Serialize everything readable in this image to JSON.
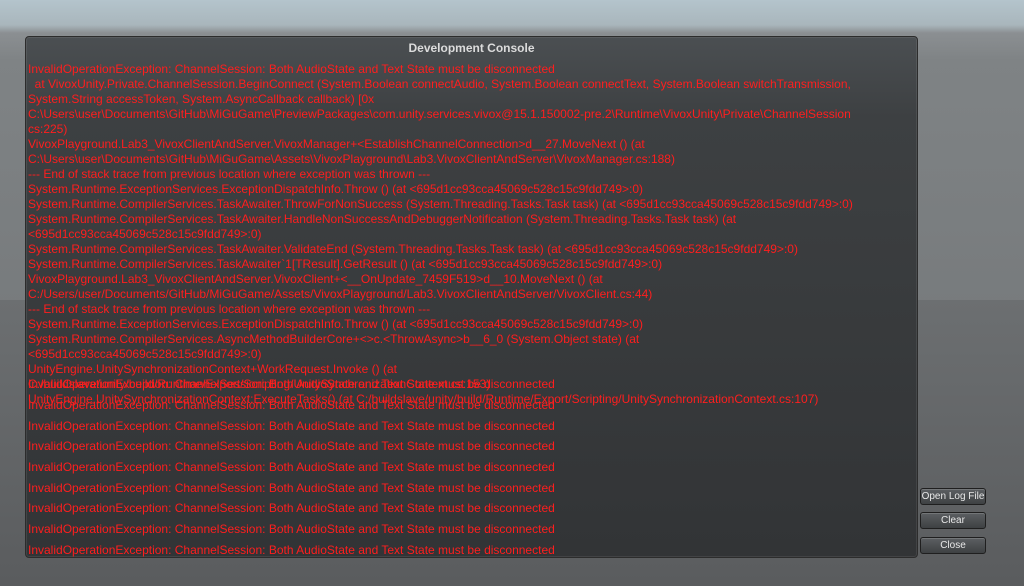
{
  "console": {
    "title": "Development Console",
    "stack_lines": [
      "InvalidOperationException: ChannelSession: Both AudioState and Text State must be disconnected",
      "  at VivoxUnity.Private.ChannelSession.BeginConnect (System.Boolean connectAudio, System.Boolean connectText, System.Boolean switchTransmission,",
      "System.String accessToken, System.AsyncCallback callback) [0x",
      "C:\\Users\\user\\Documents\\GitHub\\MiGuGame\\PreviewPackages\\com.unity.services.vivox@15.1.150002-pre.2\\Runtime\\VivoxUnity\\Private\\ChannelSession",
      "cs:225)",
      "VivoxPlayground.Lab3_VivoxClientAndServer.VivoxManager+<EstablishChannelConnection>d__27.MoveNext () (at",
      "C:\\Users\\user\\Documents\\GitHub\\MiGuGame\\Assets\\VivoxPlayground\\Lab3.VivoxClientAndServer\\VivoxManager.cs:188)",
      "--- End of stack trace from previous location where exception was thrown ---",
      "System.Runtime.ExceptionServices.ExceptionDispatchInfo.Throw () (at <695d1cc93cca45069c528c15c9fdd749>:0)",
      "System.Runtime.CompilerServices.TaskAwaiter.ThrowForNonSuccess (System.Threading.Tasks.Task task) (at <695d1cc93cca45069c528c15c9fdd749>:0)",
      "System.Runtime.CompilerServices.TaskAwaiter.HandleNonSuccessAndDebuggerNotification (System.Threading.Tasks.Task task) (at",
      "<695d1cc93cca45069c528c15c9fdd749>:0)",
      "System.Runtime.CompilerServices.TaskAwaiter.ValidateEnd (System.Threading.Tasks.Task task) (at <695d1cc93cca45069c528c15c9fdd749>:0)",
      "System.Runtime.CompilerServices.TaskAwaiter`1[TResult].GetResult () (at <695d1cc93cca45069c528c15c9fdd749>:0)",
      "VivoxPlayground.Lab3_VivoxClientAndServer.VivoxClient+<__OnUpdate_7459F519>d__10.MoveNext () (at",
      "C:/Users/user/Documents/GitHub/MiGuGame/Assets/VivoxPlayground/Lab3.VivoxClientAndServer/VivoxClient.cs:44)",
      "--- End of stack trace from previous location where exception was thrown ---",
      "System.Runtime.ExceptionServices.ExceptionDispatchInfo.Throw () (at <695d1cc93cca45069c528c15c9fdd749>:0)",
      "System.Runtime.CompilerServices.AsyncMethodBuilderCore+<>c.<ThrowAsync>b__6_0 (System.Object state) (at",
      "<695d1cc93cca45069c528c15c9fdd749>:0)",
      "UnityEngine.UnitySynchronizationContext+WorkRequest.Invoke () (at",
      "C:/buildslave/unity/build/Runtime/Export/Scripting/UnitySynchronizationContext.cs:153)",
      "UnityEngine.UnitySynchronizationContext:ExecuteTasks() (at C:/buildslave/unity/build/Runtime/Export/Scripting/UnitySynchronizationContext.cs:107)"
    ],
    "repeated_message": "InvalidOperationException: ChannelSession: Both AudioState and Text State must be disconnected",
    "repeated_rows": [
      "InvalidOperationException: ChannelSession: Both AudioState and Text State must be disconnected",
      "InvalidOperationException: ChannelSession: Both AudioState and Text State must be disconnected",
      "InvalidOperationException: ChannelSession: Both AudioState and Text State must be disconnected",
      "InvalidOperationException: ChannelSession: Both AudioState and Text State must be disconnected",
      "InvalidOperationException: ChannelSession: Both AudioState and Text State must be disconnected",
      "InvalidOperationException: ChannelSession: Both AudioState and Text State must be disconnected",
      "InvalidOperationException: ChannelSession: Both AudioState and Text State must be disconnected",
      "InvalidOperationException: ChannelSession: Both AudioState and Text State must be disconnected",
      "InvalidOperationException: ChannelSession: Both AudioState and Text State must be disconnected"
    ],
    "colors": {
      "error_text": "#ff1e1e",
      "panel_bg": "#3d4042",
      "title_text": "#dcdcdc"
    }
  },
  "buttons": {
    "open_log_file": "Open Log File",
    "clear": "Clear",
    "close": "Close"
  }
}
